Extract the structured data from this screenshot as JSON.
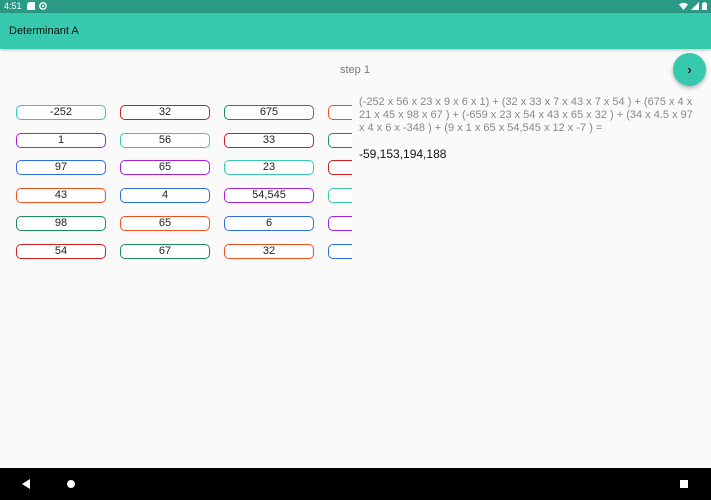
{
  "status_bar": {
    "time": "4:51"
  },
  "app_bar": {
    "title": "Determinant A"
  },
  "step": {
    "label": "step 1"
  },
  "next_button": {
    "icon": "chevron-right-icon",
    "glyph": "›"
  },
  "colors": {
    "teal": "#36c9ae",
    "green": "#1a8a5a",
    "purple": "#a620e0",
    "blue": "#2a6de0",
    "red": "#e03020",
    "orange": "#f0501e",
    "dark_red": "#d01e1e"
  },
  "matrix": {
    "rows": [
      {
        "cells": [
          {
            "value": "-252",
            "color": "#36c9ae"
          },
          {
            "value": "32",
            "color": "#d01e1e"
          },
          {
            "value": "675",
            "color": "#1a8a5a"
          },
          {
            "value": "",
            "color": "#f0501e"
          }
        ]
      },
      {
        "cells": [
          {
            "value": "1",
            "color": "#a620e0"
          },
          {
            "value": "56",
            "color": "#36c9ae"
          },
          {
            "value": "33",
            "color": "#d01e1e"
          },
          {
            "value": "",
            "color": "#1a8a5a"
          }
        ]
      },
      {
        "cells": [
          {
            "value": "97",
            "color": "#2a6de0"
          },
          {
            "value": "65",
            "color": "#a620e0"
          },
          {
            "value": "23",
            "color": "#36c9ae"
          },
          {
            "value": "",
            "color": "#d01e1e"
          }
        ]
      },
      {
        "cells": [
          {
            "value": "43",
            "color": "#f0501e"
          },
          {
            "value": "4",
            "color": "#2a6de0"
          },
          {
            "value": "54,545",
            "color": "#a620e0"
          },
          {
            "value": "",
            "color": "#36c9ae"
          }
        ]
      },
      {
        "cells": [
          {
            "value": "98",
            "color": "#1a8a5a"
          },
          {
            "value": "65",
            "color": "#f0501e"
          },
          {
            "value": "6",
            "color": "#2a6de0"
          },
          {
            "value": "",
            "color": "#a620e0"
          }
        ]
      },
      {
        "cells": [
          {
            "value": "54",
            "color": "#d01e1e"
          },
          {
            "value": "67",
            "color": "#1a8a5a"
          },
          {
            "value": "32",
            "color": "#f0501e"
          },
          {
            "value": "",
            "color": "#2a6de0"
          }
        ]
      }
    ]
  },
  "formula": "(-252 x 56 x 23 x 9 x 6 x 1)  +  (32 x 33 x 7 x 43 x 7 x 54 )  +  (675 x 4 x 21 x 45 x 98 x 67 )  +  (-659 x 23 x 54 x 43 x 65 x 32 )  +  (34 x 4.5 x 97 x 4 x 6 x -348 )  +  (9 x 1 x 65 x 54,545 x 12 x -7 )  =",
  "result": "-59,153,194,188"
}
